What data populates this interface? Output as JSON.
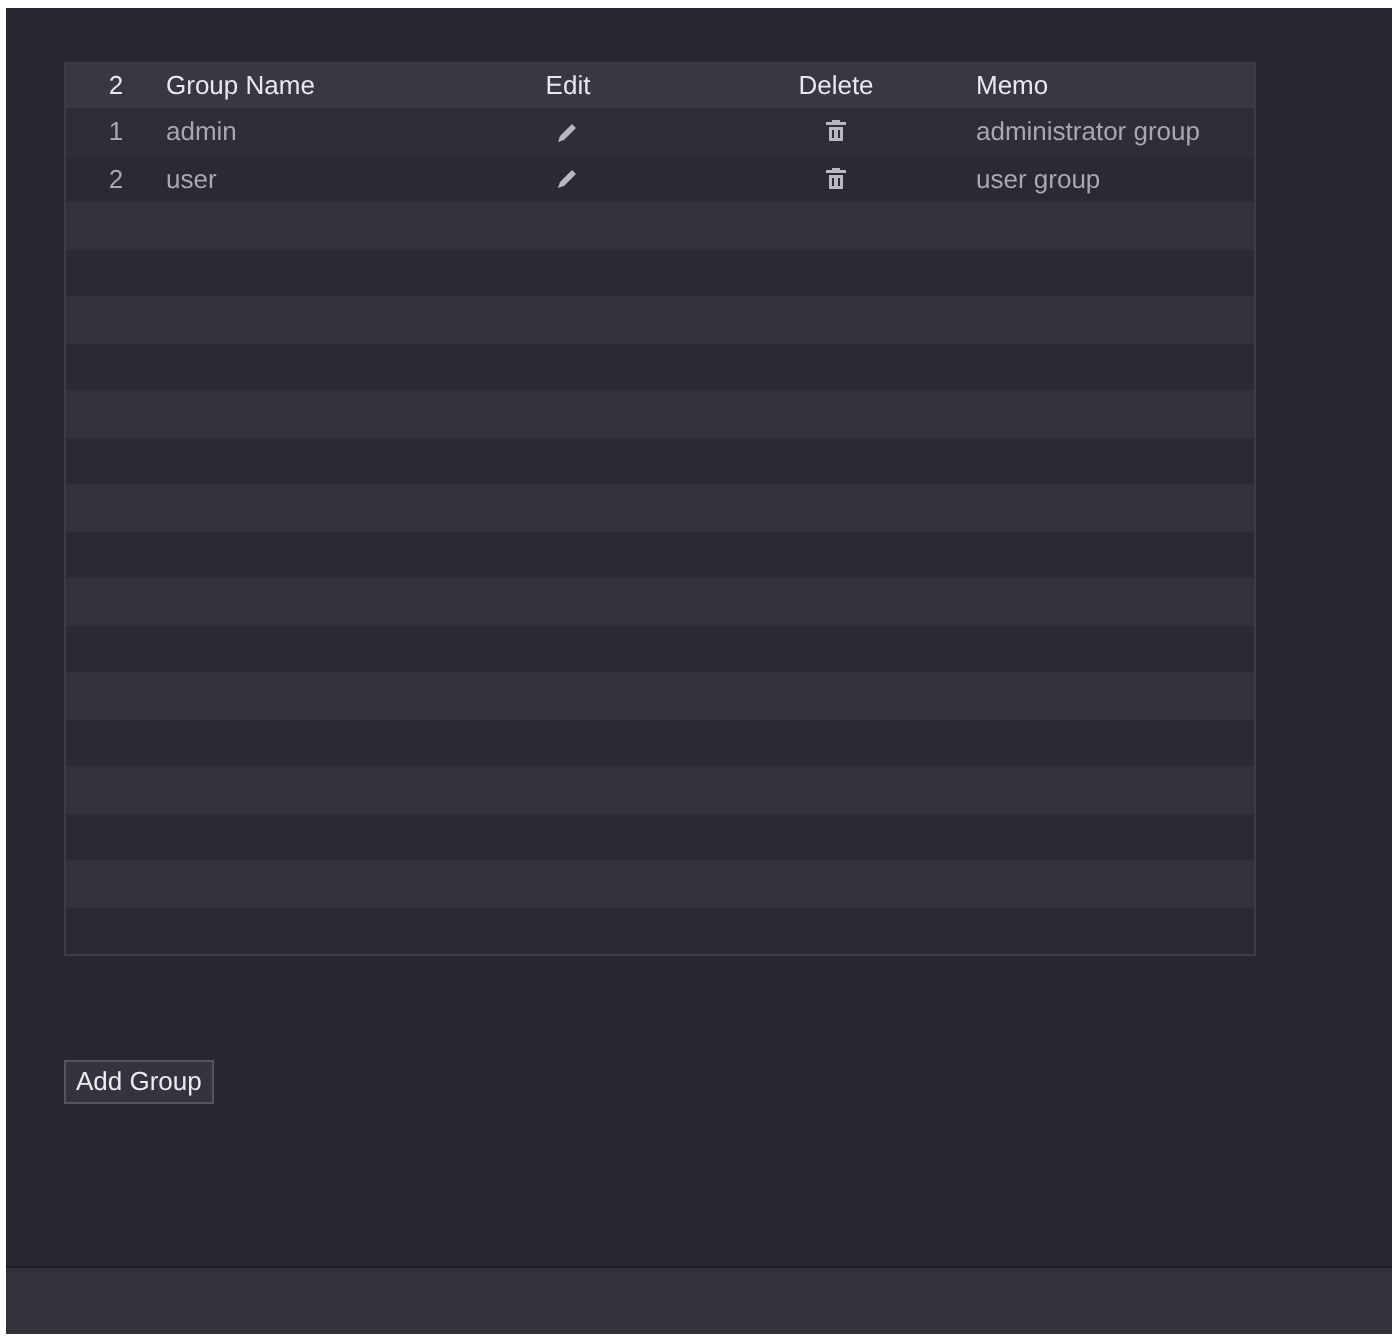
{
  "table": {
    "columns": [
      {
        "label": "2"
      },
      {
        "label": "Group Name"
      },
      {
        "label": "Edit"
      },
      {
        "label": "Delete"
      },
      {
        "label": "Memo"
      }
    ],
    "rows": [
      {
        "index": "1",
        "group_name": "admin",
        "memo": "administrator group"
      },
      {
        "index": "2",
        "group_name": "user",
        "memo": "user group"
      }
    ]
  },
  "add_button": "Add Group"
}
